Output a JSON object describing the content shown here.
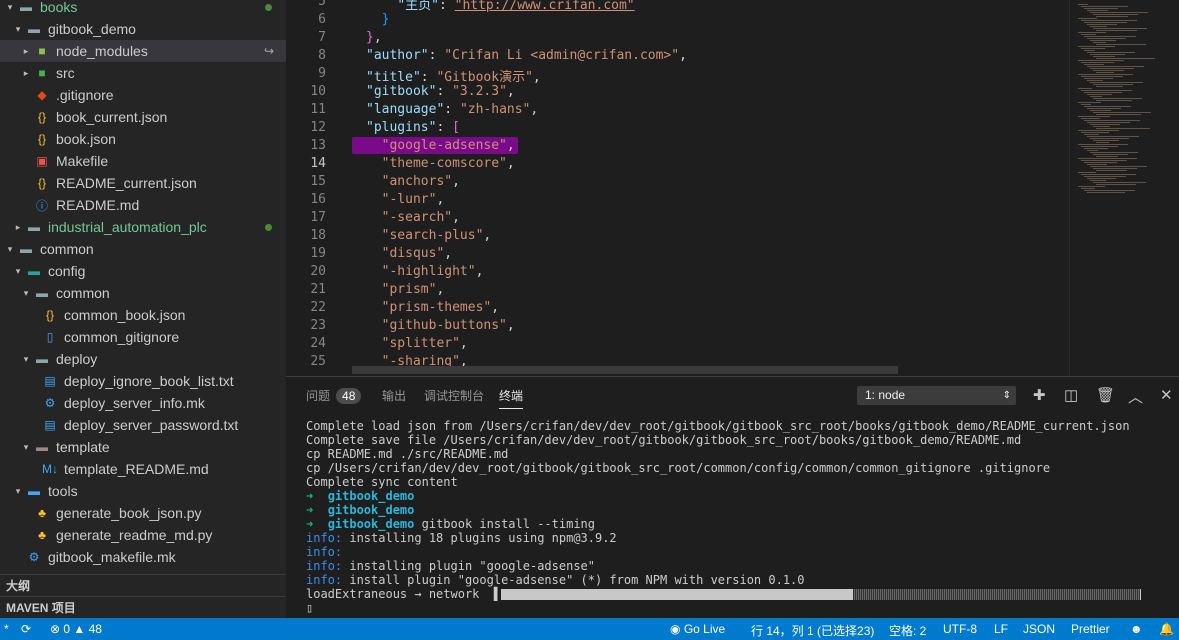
{
  "sidebar": {
    "tree": [
      {
        "label": "books",
        "depth": 0,
        "tw": "▾",
        "icon": "folder-icon",
        "glyph": "▬",
        "icolor": "#90a4ae",
        "color": "#73c991",
        "dot": true
      },
      {
        "label": "gitbook_demo",
        "depth": 1,
        "tw": "▾",
        "icon": "folder-open-icon",
        "glyph": "▬",
        "icolor": "#90a4ae"
      },
      {
        "label": "node_modules",
        "depth": 2,
        "tw": "▸",
        "icon": "node-folder-icon",
        "glyph": "■",
        "icolor": "#8bc34a",
        "sel": true,
        "arr": true
      },
      {
        "label": "src",
        "depth": 2,
        "tw": "▸",
        "icon": "src-folder-icon",
        "glyph": "■",
        "icolor": "#4caf50"
      },
      {
        "label": ".gitignore",
        "depth": 2,
        "icon": "git-icon",
        "glyph": "◆",
        "icolor": "#e64a19"
      },
      {
        "label": "book_current.json",
        "depth": 2,
        "icon": "json-icon",
        "glyph": "{}",
        "icolor": "#fbc02d"
      },
      {
        "label": "book.json",
        "depth": 2,
        "icon": "json-icon",
        "glyph": "{}",
        "icolor": "#fbc02d"
      },
      {
        "label": "Makefile",
        "depth": 2,
        "icon": "makefile-icon",
        "glyph": "▣",
        "icolor": "#ef5350"
      },
      {
        "label": "README_current.json",
        "depth": 2,
        "icon": "json-icon",
        "glyph": "{}",
        "icolor": "#fbc02d"
      },
      {
        "label": "README.md",
        "depth": 2,
        "icon": "info-icon",
        "glyph": "ⓘ",
        "icolor": "#42a5f5"
      },
      {
        "label": "industrial_automation_plc",
        "depth": 1,
        "tw": "▸",
        "icon": "folder-icon",
        "glyph": "▬",
        "icolor": "#90a4ae",
        "color": "#73c991",
        "dot": true
      },
      {
        "label": "common",
        "depth": 0,
        "tw": "▾",
        "icon": "folder-open-icon",
        "glyph": "▬",
        "icolor": "#90a4ae"
      },
      {
        "label": "config",
        "depth": 1,
        "tw": "▾",
        "icon": "config-folder-icon",
        "glyph": "▬",
        "icolor": "#26a69a"
      },
      {
        "label": "common",
        "depth": 2,
        "tw": "▾",
        "icon": "folder-open-icon",
        "glyph": "▬",
        "icolor": "#90a4ae"
      },
      {
        "label": "common_book.json",
        "depth": 3,
        "icon": "json-icon",
        "glyph": "{}",
        "icolor": "#fbc02d"
      },
      {
        "label": "common_gitignore",
        "depth": 3,
        "icon": "file-icon",
        "glyph": "▯",
        "icolor": "#42a5f5"
      },
      {
        "label": "deploy",
        "depth": 2,
        "tw": "▾",
        "icon": "folder-open-icon",
        "glyph": "▬",
        "icolor": "#90a4ae"
      },
      {
        "label": "deploy_ignore_book_list.txt",
        "depth": 3,
        "icon": "text-file-icon",
        "glyph": "▤",
        "icolor": "#42a5f5"
      },
      {
        "label": "deploy_server_info.mk",
        "depth": 3,
        "icon": "gear-icon",
        "glyph": "⚙",
        "icolor": "#42a5f5"
      },
      {
        "label": "deploy_server_password.txt",
        "depth": 3,
        "icon": "text-file-icon",
        "glyph": "▤",
        "icolor": "#42a5f5"
      },
      {
        "label": "template",
        "depth": 2,
        "tw": "▾",
        "icon": "folder-open-icon",
        "glyph": "▬",
        "icolor": "#a1887f"
      },
      {
        "label": "template_README.md",
        "depth": 3,
        "icon": "markdown-icon",
        "glyph": "M↓",
        "icolor": "#42a5f5"
      },
      {
        "label": "tools",
        "depth": 1,
        "tw": "▾",
        "icon": "tools-folder-icon",
        "glyph": "▬",
        "icolor": "#42a5f5"
      },
      {
        "label": "generate_book_json.py",
        "depth": 2,
        "icon": "python-icon",
        "glyph": "♣",
        "icolor": "#fbc02d"
      },
      {
        "label": "generate_readme_md.py",
        "depth": 2,
        "icon": "python-icon",
        "glyph": "♣",
        "icolor": "#fbc02d"
      },
      {
        "label": "gitbook_makefile.mk",
        "depth": 1,
        "icon": "gear-icon",
        "glyph": "⚙",
        "icolor": "#42a5f5"
      }
    ],
    "outline_label": "大纲",
    "maven_label": "MAVEN 项目"
  },
  "editor": {
    "lines": [
      {
        "n": "5",
        "html": "<span class='p'>    </span><span class='k'>\"主页\"</span><span class='p'>: </span><span class='u'>\"http://www.crifan.com\"</span>"
      },
      {
        "n": "6",
        "html": "<span class='p'>  </span><span class='b' style='color:#179fff'>}</span>"
      },
      {
        "n": "7",
        "html": "<span class='b'>}</span><span class='p'>,</span>"
      },
      {
        "n": "8",
        "html": "<span class='k'>\"author\"</span><span class='p'>: </span>\"Crifan Li &lt;admin@crifan.com&gt;\"<span class='p'>,</span>"
      },
      {
        "n": "9",
        "html": "<span class='k'>\"title\"</span><span class='p'>: </span>\"Gitbook演示\"<span class='p'>,</span>"
      },
      {
        "n": "10",
        "html": "<span class='k'>\"gitbook\"</span><span class='p'>: </span>\"3.2.3\"<span class='p'>,</span>"
      },
      {
        "n": "11",
        "html": "<span class='k'>\"language\"</span><span class='p'>: </span>\"zh-hans\"<span class='p'>,</span>"
      },
      {
        "n": "12",
        "html": "<span class='k'>\"plugins\"</span><span class='p'>: </span><span class='b'>[</span>"
      },
      {
        "n": "13",
        "html": "  \"google-adsense\"<span class='p'>,</span>"
      },
      {
        "n": "14",
        "html": "  \"theme-comscore\"<span class='p'>,</span>",
        "cur": true
      },
      {
        "n": "15",
        "html": "  \"anchors\"<span class='p'>,</span>"
      },
      {
        "n": "16",
        "html": "  \"-lunr\"<span class='p'>,</span>"
      },
      {
        "n": "17",
        "html": "  \"-search\"<span class='p'>,</span>"
      },
      {
        "n": "18",
        "html": "  \"search-plus\"<span class='p'>,</span>"
      },
      {
        "n": "19",
        "html": "  \"disqus\"<span class='p'>,</span>"
      },
      {
        "n": "20",
        "html": "  \"-highlight\"<span class='p'>,</span>"
      },
      {
        "n": "21",
        "html": "  \"prism\"<span class='p'>,</span>"
      },
      {
        "n": "22",
        "html": "  \"prism-themes\"<span class='p'>,</span>"
      },
      {
        "n": "23",
        "html": "  \"github-buttons\"<span class='p'>,</span>"
      },
      {
        "n": "24",
        "html": "  \"splitter\"<span class='p'>,</span>"
      },
      {
        "n": "25",
        "html": "  \"-sharing\"<span class='p'>,</span>"
      }
    ]
  },
  "panel": {
    "tabs": {
      "problems": "问题",
      "problems_count": "48",
      "output": "输出",
      "debug": "调试控制台",
      "terminal": "终端"
    },
    "terminal_select": "1: node",
    "terminal_lines": [
      "Complete load json from /Users/crifan/dev/dev_root/gitbook/gitbook_src_root/books/gitbook_demo/README_current.json",
      "Complete save file /Users/crifan/dev/dev_root/gitbook/gitbook_src_root/books/gitbook_demo/README.md",
      "cp README.md ./src/README.md",
      "cp /Users/crifan/dev/dev_root/gitbook/gitbook_src_root/common/config/common/common_gitignore .gitignore",
      "Complete sync content"
    ],
    "prompts": [
      {
        "arrow": "➜",
        "dir": "gitbook_demo",
        "cmd": ""
      },
      {
        "arrow": "➜",
        "dir": "gitbook_demo",
        "cmd": ""
      },
      {
        "arrow": "➜",
        "dir": "gitbook_demo",
        "cmd": " gitbook install --timing"
      }
    ],
    "info_lines": [
      {
        "tag": "info:",
        "text": " installing 18 plugins using npm@3.9.2"
      },
      {
        "tag": "info:",
        "text": ""
      },
      {
        "tag": "info:",
        "text": " installing plugin \"google-adsense\""
      },
      {
        "tag": "info:",
        "text": " install plugin \"google-adsense\" (*) from NPM with version 0.1.0"
      }
    ],
    "progress_label": "loadExtraneous → network",
    "progress_fraction": 0.55
  },
  "status": {
    "errors": "0",
    "warnings": "48",
    "go_live": "Go Live",
    "position": "行 14，列 1 (已选择23)",
    "indent": "空格: 2",
    "encoding": "UTF-8",
    "eol": "LF",
    "language": "JSON",
    "prettier": "Prettier"
  }
}
